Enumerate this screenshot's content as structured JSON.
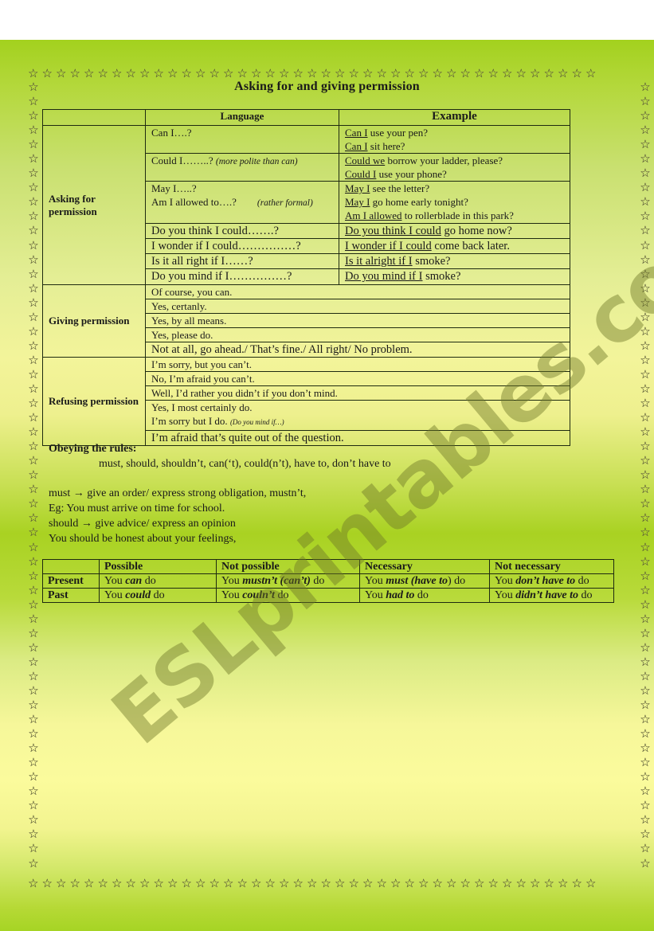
{
  "title": "Asking for and giving permission",
  "main_table": {
    "headers": [
      "",
      "Language",
      "Example"
    ],
    "asking": {
      "category": "Asking for permission",
      "rows": [
        {
          "lang": "Can I….?",
          "lang_note": "",
          "examples": [
            {
              "u": "Can I",
              "rest": " use your pen?"
            },
            {
              "u": "Can I",
              "rest": " sit here?"
            }
          ]
        },
        {
          "lang": "Could I……..? ",
          "lang_note": "(more polite than can)",
          "examples": [
            {
              "u": "Could we",
              "rest": " borrow your ladder, please?"
            },
            {
              "u": "Could I",
              "rest": " use your phone?"
            }
          ]
        },
        {
          "lang": "May I…..?",
          "lang2": "Am I allowed to….?",
          "lang_note": "(rather formal)",
          "examples": [
            {
              "u": "May I",
              "rest": " see the letter?"
            },
            {
              "u": "May I",
              "rest": " go home early tonight?"
            },
            {
              "u": "Am I allowed",
              "rest": " to rollerblade in this park?"
            }
          ]
        },
        {
          "lang": "Do you think I could…….?",
          "examples": [
            {
              "u": "Do you think I could",
              "rest": " go home now?"
            }
          ]
        },
        {
          "lang": "I wonder if I could……………?",
          "examples": [
            {
              "u": "I wonder if I could",
              "rest": " come back later."
            }
          ]
        },
        {
          "lang": "Is it all right if I……?",
          "examples": [
            {
              "u": "Is it alright if I",
              "rest": " smoke?"
            }
          ]
        },
        {
          "lang": "Do you mind if I……………?",
          "examples": [
            {
              "u": "Do you mind if I",
              "rest": " smoke?"
            }
          ]
        }
      ]
    },
    "giving": {
      "category": "Giving permission",
      "rows": [
        "Of course, you can.",
        "Yes, certanly.",
        "Yes, by all means.",
        "Yes, please do.",
        "Not at all, go ahead./ That’s fine./ All right/ No problem."
      ]
    },
    "refusing": {
      "category": "Refusing permission",
      "rows": [
        "I’m sorry, but you can’t.",
        "No, I’m afraid you can’t.",
        "Well, I’d rather you didn’t if you don’t mind."
      ],
      "multi": {
        "line1": "Yes, I most certainly do.",
        "line2": "I’m sorry but I do. ",
        "note": "(Do you mind if…)"
      },
      "last": "I’m afraid that’s quite out of the question."
    }
  },
  "rules": {
    "heading": "Obeying the rules:",
    "modals": "must, should, shouldn’t, can(‘t), could(n’t), have to, don’t have to",
    "must_word": "must",
    "must_def": "give an order/ express strong obligation, mustn’t,",
    "must_example": "Eg: You must arrive on time for school.",
    "should_word": "should",
    "should_def": "give advice/ express an opinion",
    "should_example": "You should be honest about your feelings,",
    "arrow": "→"
  },
  "modal_table": {
    "headers": [
      "",
      "Possible",
      "Not possible",
      "Necessary",
      "Not necessary"
    ],
    "rows": [
      {
        "label": "Present",
        "cells": [
          {
            "pre": "You ",
            "em": "can",
            "post": " do"
          },
          {
            "pre": "You ",
            "em": "mustn’t (can’t)",
            "post": " do"
          },
          {
            "pre": "You ",
            "em": "must (have to",
            "post": ") do"
          },
          {
            "pre": "You ",
            "em": "don’t have to",
            "post": " do"
          }
        ]
      },
      {
        "label": "Past",
        "cells": [
          {
            "pre": "You ",
            "em": "could",
            "post": " do"
          },
          {
            "pre": "You ",
            "em": "couln’t",
            "post": " do"
          },
          {
            "pre": "You ",
            "em": "had to",
            "post": " do"
          },
          {
            "pre": "You ",
            "em": "didn’t have to",
            "post": " do"
          }
        ]
      }
    ]
  },
  "watermark": "ESLprintables.com",
  "border_icon": "☆"
}
